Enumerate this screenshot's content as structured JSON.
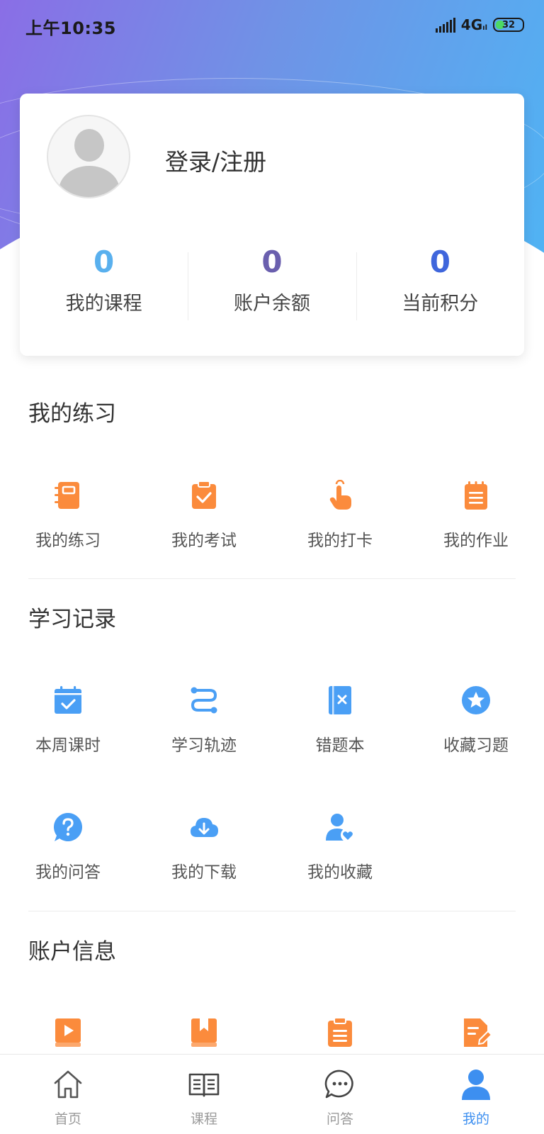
{
  "status_bar": {
    "time": "上午10:35",
    "network": "4G",
    "network_sub": "ıl",
    "battery": "32"
  },
  "profile": {
    "login_text": "登录/注册"
  },
  "stats": [
    {
      "value": "0",
      "label": "我的课程",
      "color": "#59b0ee"
    },
    {
      "value": "0",
      "label": "账户余额",
      "color": "#6a5fae"
    },
    {
      "value": "0",
      "label": "当前积分",
      "color": "#3f66dc"
    }
  ],
  "sections": {
    "practice": {
      "title": "我的练习",
      "items": [
        {
          "label": "我的练习",
          "icon": "notebook-icon"
        },
        {
          "label": "我的考试",
          "icon": "clipboard-check-icon"
        },
        {
          "label": "我的打卡",
          "icon": "finger-tap-icon"
        },
        {
          "label": "我的作业",
          "icon": "notepad-icon"
        }
      ]
    },
    "records": {
      "title": "学习记录",
      "items": [
        {
          "label": "本周课时",
          "icon": "calendar-check-icon"
        },
        {
          "label": "学习轨迹",
          "icon": "route-icon"
        },
        {
          "label": "错题本",
          "icon": "wrong-book-icon"
        },
        {
          "label": "收藏习题",
          "icon": "star-circle-icon"
        },
        {
          "label": "我的问答",
          "icon": "question-bubble-icon"
        },
        {
          "label": "我的下载",
          "icon": "cloud-download-icon"
        },
        {
          "label": "我的收藏",
          "icon": "user-heart-icon"
        }
      ]
    },
    "account": {
      "title": "账户信息",
      "items": [
        {
          "icon": "video-book-icon"
        },
        {
          "icon": "bookmark-book-icon"
        },
        {
          "icon": "clipboard-list-icon"
        },
        {
          "icon": "doc-edit-icon"
        }
      ]
    }
  },
  "colors": {
    "orange": "#fb8b3c",
    "blue": "#4a9ff5",
    "tab_active": "#3d8ff0",
    "tab_inactive": "#9a9a9a"
  },
  "tabbar": [
    {
      "label": "首页",
      "icon": "home-icon",
      "active": false
    },
    {
      "label": "课程",
      "icon": "book-open-icon",
      "active": false
    },
    {
      "label": "问答",
      "icon": "chat-bubble-icon",
      "active": false
    },
    {
      "label": "我的",
      "icon": "user-icon",
      "active": true
    }
  ]
}
